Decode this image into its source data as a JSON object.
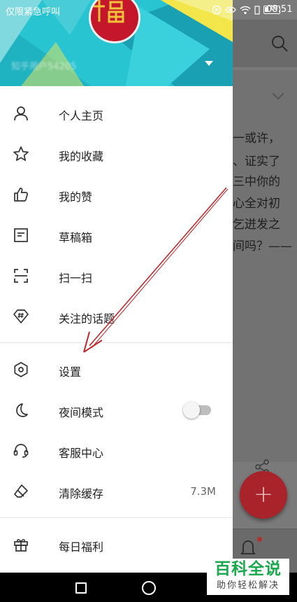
{
  "status_bar": {
    "carrier": "仅限紧急呼叫",
    "battery": "19",
    "time": "08:51"
  },
  "background_feed": {
    "text_lines": [
      "一或许，",
      "、证实了",
      "三中你的",
      "心全对初",
      "乞迸发之",
      "间吗？——"
    ]
  },
  "drawer": {
    "username": "知乎用户54205",
    "menu": [
      {
        "label": "个人主页",
        "icon": "person-icon"
      },
      {
        "label": "我的收藏",
        "icon": "star-icon"
      },
      {
        "label": "我的赞",
        "icon": "thumbs-up-icon"
      },
      {
        "label": "草稿箱",
        "icon": "draft-icon"
      },
      {
        "label": "扫一扫",
        "icon": "scan-icon"
      },
      {
        "label": "关注的话题",
        "icon": "topic-tag-icon"
      },
      {
        "label": "设置",
        "icon": "settings-hexagon-icon"
      },
      {
        "label": "夜间模式",
        "icon": "moon-icon"
      },
      {
        "label": "客服中心",
        "icon": "headset-icon"
      },
      {
        "label": "清除缓存",
        "icon": "eraser-icon",
        "value": "7.3M"
      },
      {
        "label": "每日福利",
        "icon": "gift-icon"
      }
    ],
    "night_mode_enabled": false
  },
  "fab": {
    "label": "+"
  },
  "watermark": {
    "title": "百科全说",
    "subtitle": "助你轻松解决"
  },
  "colors": {
    "header_teal": "#29c4d2",
    "accent_red": "#a8232a",
    "annotation_arrow": "#c0282b"
  }
}
